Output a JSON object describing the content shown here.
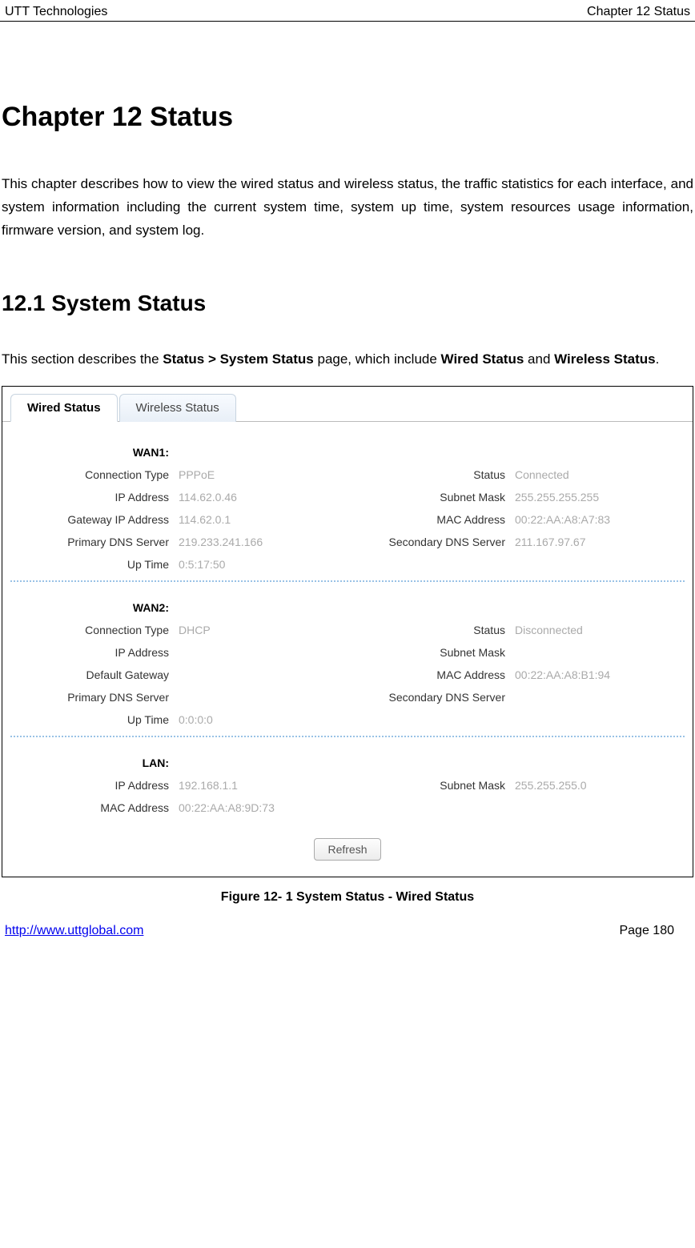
{
  "header": {
    "left": "UTT Technologies",
    "right": "Chapter 12 Status"
  },
  "chapter_title": "Chapter 12  Status",
  "intro": "This chapter describes how to view the wired status and wireless status, the traffic statistics for each interface, and system information including the current system time, system up time, system resources usage information, firmware version, and system log.",
  "section_title": "12.1   System Status",
  "section_intro_prefix": "This section describes the ",
  "section_intro_bold1": "Status > System Status",
  "section_intro_mid": " page, which include ",
  "section_intro_bold2": "Wired Status",
  "section_intro_and": " and ",
  "section_intro_bold3": "Wireless Status",
  "section_intro_end": ".",
  "tabs": {
    "wired": "Wired Status",
    "wireless": "Wireless Status"
  },
  "wan1": {
    "title": "WAN1:",
    "rows": [
      {
        "l1": "Connection Type",
        "v1": "PPPoE",
        "l2": "Status",
        "v2": "Connected"
      },
      {
        "l1": "IP Address",
        "v1": "114.62.0.46",
        "l2": "Subnet Mask",
        "v2": "255.255.255.255"
      },
      {
        "l1": "Gateway IP Address",
        "v1": "114.62.0.1",
        "l2": "MAC Address",
        "v2": "00:22:AA:A8:A7:83"
      },
      {
        "l1": "Primary DNS Server",
        "v1": "219.233.241.166",
        "l2": "Secondary DNS Server",
        "v2": "211.167.97.67"
      },
      {
        "l1": "Up Time",
        "v1": "0:5:17:50",
        "l2": "",
        "v2": ""
      }
    ]
  },
  "wan2": {
    "title": "WAN2:",
    "rows": [
      {
        "l1": "Connection Type",
        "v1": "DHCP",
        "l2": "Status",
        "v2": "Disconnected"
      },
      {
        "l1": "IP Address",
        "v1": "",
        "l2": "Subnet Mask",
        "v2": ""
      },
      {
        "l1": "Default Gateway",
        "v1": "",
        "l2": "MAC Address",
        "v2": "00:22:AA:A8:B1:94"
      },
      {
        "l1": "Primary DNS Server",
        "v1": "",
        "l2": "Secondary DNS Server",
        "v2": ""
      },
      {
        "l1": "Up Time",
        "v1": "0:0:0:0",
        "l2": "",
        "v2": ""
      }
    ]
  },
  "lan": {
    "title": "LAN:",
    "rows": [
      {
        "l1": "IP Address",
        "v1": "192.168.1.1",
        "l2": "Subnet Mask",
        "v2": "255.255.255.0"
      },
      {
        "l1": "MAC Address",
        "v1": "00:22:AA:A8:9D:73",
        "l2": "",
        "v2": ""
      }
    ]
  },
  "refresh_label": "Refresh",
  "figure_caption": "Figure 12- 1 System Status - Wired Status",
  "footer": {
    "url": "http://www.uttglobal.com",
    "page": "Page 180"
  }
}
